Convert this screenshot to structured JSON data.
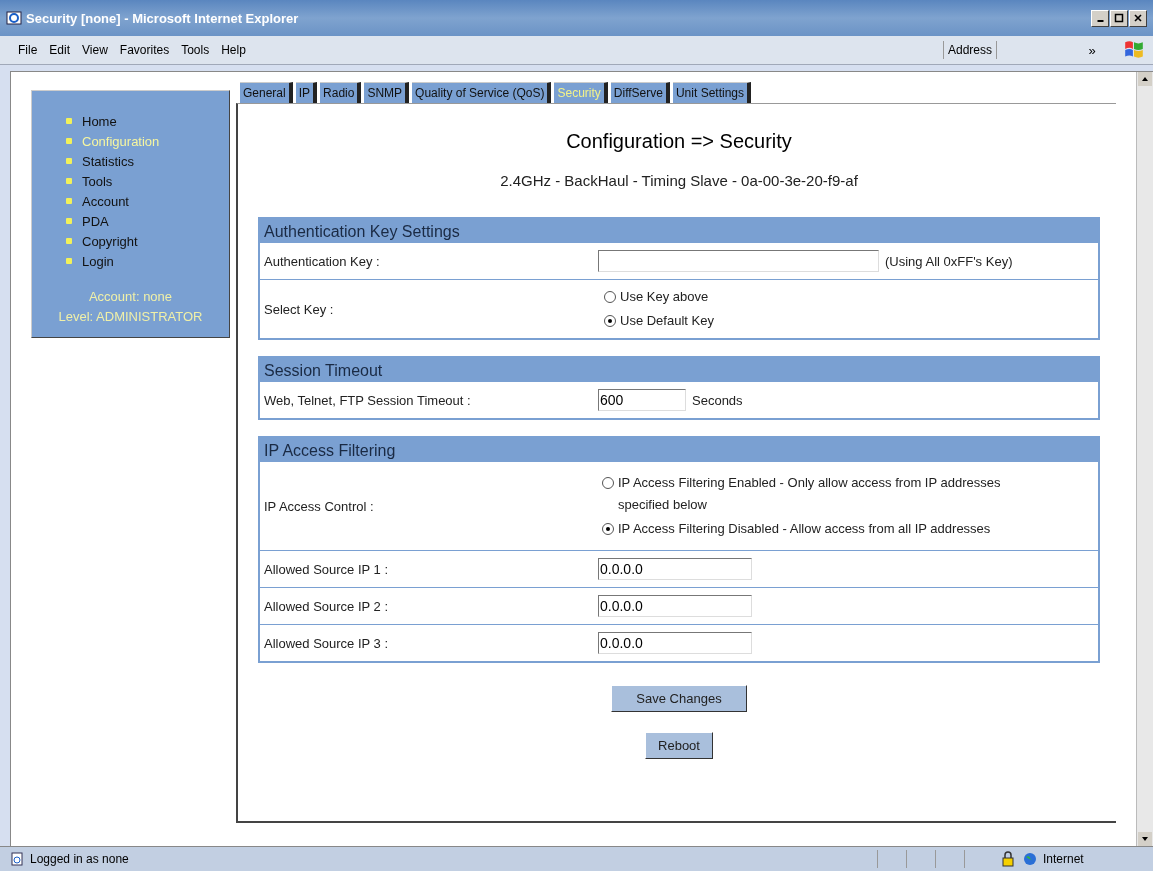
{
  "window": {
    "title": "Security [none] - Microsoft Internet Explorer"
  },
  "menu": [
    "File",
    "Edit",
    "View",
    "Favorites",
    "Tools",
    "Help"
  ],
  "address_label": "Address",
  "toolbar_more": "»",
  "sidebar": {
    "items": [
      {
        "label": "Home",
        "selected": false
      },
      {
        "label": "Configuration",
        "selected": true
      },
      {
        "label": "Statistics",
        "selected": false
      },
      {
        "label": "Tools",
        "selected": false
      },
      {
        "label": "Account",
        "selected": false
      },
      {
        "label": "PDA",
        "selected": false
      },
      {
        "label": "Copyright",
        "selected": false
      },
      {
        "label": "Login",
        "selected": false
      }
    ],
    "account": "Account: none",
    "level": "Level: ADMINISTRATOR"
  },
  "tabs": [
    {
      "label": "General",
      "selected": false
    },
    {
      "label": "IP",
      "selected": false
    },
    {
      "label": "Radio",
      "selected": false
    },
    {
      "label": "SNMP",
      "selected": false
    },
    {
      "label": "Quality of Service (QoS)",
      "selected": false
    },
    {
      "label": "Security",
      "selected": true
    },
    {
      "label": "DiffServe",
      "selected": false
    },
    {
      "label": "Unit Settings",
      "selected": false
    }
  ],
  "heading": "Configuration => Security",
  "subtitle": "2.4GHz - BackHaul - Timing Slave - 0a-00-3e-20-f9-af",
  "sections": [
    {
      "title": "Authentication Key Settings",
      "rows": [
        {
          "kind": "field",
          "label": "Authentication Key :",
          "value": "",
          "note": "(Using All 0xFF's Key)"
        },
        {
          "kind": "radios",
          "label": "Select Key :",
          "options": [
            {
              "label": "Use Key above",
              "selected": false
            },
            {
              "label": "Use Default Key",
              "selected": true
            }
          ]
        }
      ]
    },
    {
      "title": "Session Timeout",
      "rows": [
        {
          "kind": "field",
          "label": "Web, Telnet, FTP Session Timeout :",
          "value": "600",
          "note": "Seconds"
        }
      ]
    },
    {
      "title": "IP Access Filtering",
      "rows": [
        {
          "kind": "radios",
          "label": "IP Access Control :",
          "options": [
            {
              "label": "IP Access Filtering Enabled - Only allow access from IP addresses specified below",
              "selected": false
            },
            {
              "label": "IP Access Filtering Disabled - Allow access from all IP addresses",
              "selected": true
            }
          ]
        },
        {
          "kind": "field",
          "label": "Allowed Source IP 1 :",
          "value": "0.0.0.0"
        },
        {
          "kind": "field",
          "label": "Allowed Source IP 2 :",
          "value": "0.0.0.0"
        },
        {
          "kind": "field",
          "label": "Allowed Source IP 3 :",
          "value": "0.0.0.0"
        }
      ]
    }
  ],
  "buttons": [
    "Save Changes",
    "Reboot"
  ],
  "status_bar": {
    "text": "Logged in as none",
    "zone": "Internet"
  }
}
